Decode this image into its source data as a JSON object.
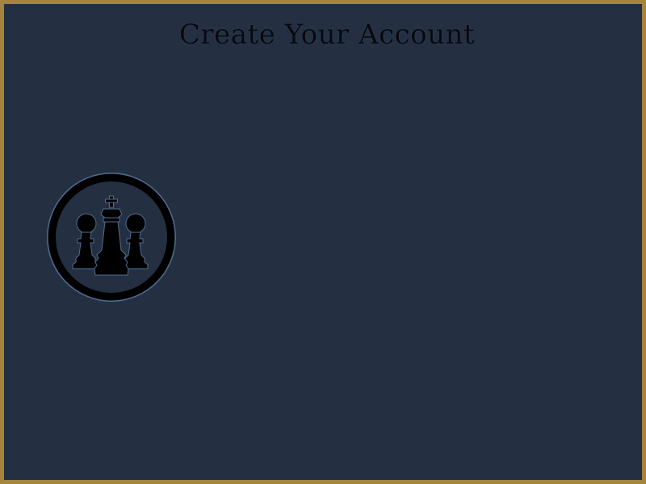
{
  "page": {
    "title": "Create Your Account"
  },
  "logo": {
    "icon": "chess-pieces-icon",
    "ring_color": "#000000",
    "outline_color": "#4f6e93"
  },
  "colors": {
    "background": "#243042",
    "border": "#a5843c",
    "title_text": "#06090f"
  }
}
